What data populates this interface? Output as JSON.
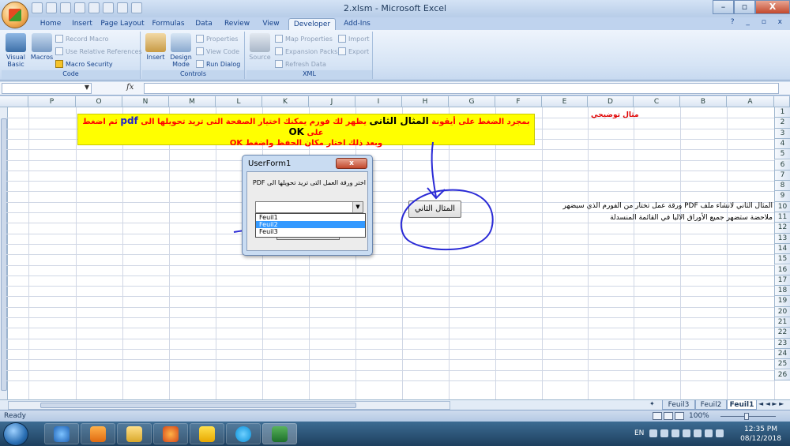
{
  "window": {
    "title": "2.xlsm - Microsoft Excel",
    "min": "–",
    "max": "▫",
    "close": "X"
  },
  "tabs": [
    "Home",
    "Insert",
    "Page Layout",
    "Formulas",
    "Data",
    "Review",
    "View",
    "Developer",
    "Add-Ins"
  ],
  "ribbon_right": "? _ ▫ x",
  "ribbon": {
    "code": {
      "label": "Code",
      "visual_basic": "Visual Basic",
      "macros": "Macros",
      "record_macro": "Record Macro",
      "relative_refs": "Use Relative References",
      "macro_security": "Macro Security"
    },
    "controls": {
      "label": "Controls",
      "insert": "Insert",
      "design_mode": "Design Mode",
      "properties": "Properties",
      "view_code": "View Code",
      "run_dialog": "Run Dialog"
    },
    "xml": {
      "label": "XML",
      "source": "Source",
      "map_properties": "Map Properties",
      "expansion_packs": "Expansion Packs",
      "refresh_data": "Refresh Data",
      "import": "Import",
      "export": "Export"
    }
  },
  "formula_bar": {
    "fx": "fx"
  },
  "columns": [
    "P",
    "O",
    "N",
    "M",
    "L",
    "K",
    "J",
    "I",
    "H",
    "G",
    "F",
    "E",
    "D",
    "C",
    "B",
    "A"
  ],
  "rows": [
    "1",
    "2",
    "3",
    "4",
    "5",
    "6",
    "7",
    "8",
    "9",
    "10",
    "11",
    "12",
    "13",
    "14",
    "15",
    "16",
    "17",
    "18",
    "19",
    "20",
    "21",
    "22",
    "23",
    "24",
    "25",
    "26"
  ],
  "sheet": {
    "d1": "مثال توضيحي",
    "banner_line1_a": "بمجرد الضغط على أيقونة ",
    "banner_line1_b": "المثال الثانى",
    "banner_line1_c": " يظهر لك فورم يمكنك اختيار الصفحة التى تريد تحويلها الى ",
    "banner_pdf": "pdf",
    "banner_line1_d": " ثم اضغط على ",
    "banner_ok": "OK",
    "banner_line2": "وبعد ذلك اختار مكان الحفظ واضغط ",
    "banner_ok2": "OK",
    "note1": "المثال الثاني  لانشاء ملف PDF ورقة عمل تختار من الفورم الذي سيضهر",
    "note2": "ملاحضة ستضهر جميع الأوراق الاليا في القائمة المنسدلة",
    "button": "المثال الثاني"
  },
  "userform": {
    "title": "UserForm1",
    "close": "x",
    "label": "اختر ورقة العمل التى تريد تحويلها الى PDF",
    "options": [
      "Feuil1",
      "Feuil2",
      "Feuil3"
    ],
    "selected_index": 1
  },
  "sheet_tabs": [
    "Feuil3",
    "Feuil2",
    "Feuil1"
  ],
  "active_sheet": "Feuil1",
  "status": {
    "ready": "Ready",
    "zoom": "100%"
  },
  "taskbar": {
    "lang": "EN",
    "time": "12:35 PM",
    "date": "08/12/2018"
  }
}
